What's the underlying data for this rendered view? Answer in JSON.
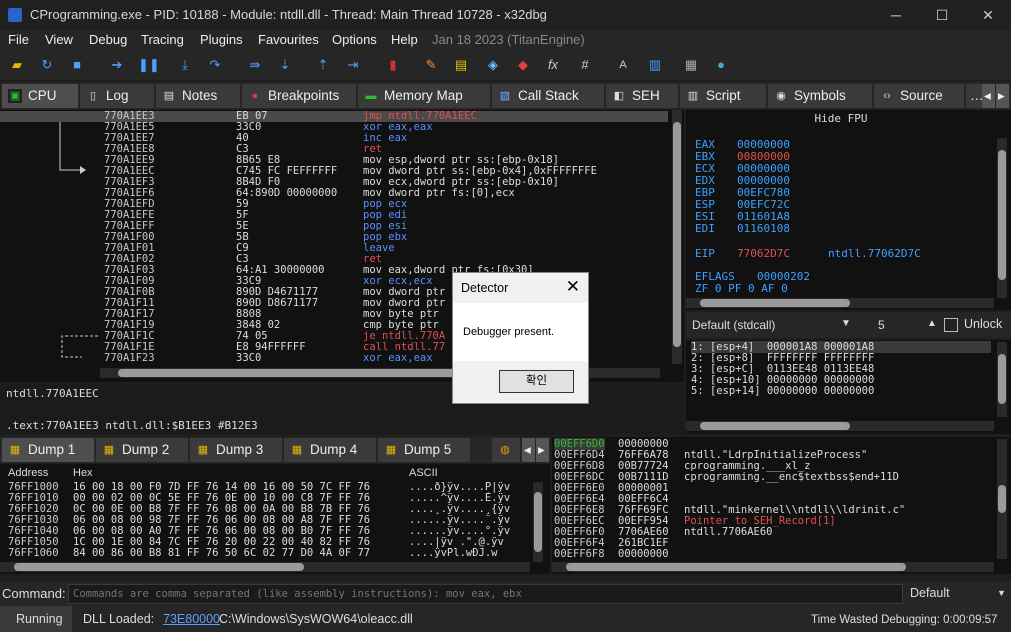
{
  "window": {
    "title": "CProgramming.exe - PID: 10188 - Module: ntdll.dll - Thread: Main Thread 10728 - x32dbg",
    "minimize": "─",
    "maximize": "☐",
    "close": "✕"
  },
  "menu": [
    "File",
    "View",
    "Debug",
    "Tracing",
    "Plugins",
    "Favourites",
    "Options",
    "Help",
    "Jan 18 2023 (TitanEngine)"
  ],
  "toolbar_icons": [
    "open-icon",
    "restart-icon",
    "stop-icon",
    "run-icon",
    "pause-icon",
    "step-into-icon",
    "step-over-icon",
    "trace-into-icon",
    "trace-over-icon",
    "execute-till-return-icon",
    "run-to-user-code-icon",
    "scylla-icon",
    "patch-icon",
    "comment-icon",
    "label-icon",
    "bookmark-icon",
    "function-icon",
    "hash-icon",
    "font-icon",
    "script-icon",
    "calculator-icon",
    "help-icon"
  ],
  "tabs": [
    {
      "label": "CPU",
      "icon": "cpu-icon"
    },
    {
      "label": "Log",
      "icon": "log-icon"
    },
    {
      "label": "Notes",
      "icon": "notes-icon"
    },
    {
      "label": "Breakpoints",
      "icon": "breakpoint-icon"
    },
    {
      "label": "Memory Map",
      "icon": "memory-map-icon"
    },
    {
      "label": "Call Stack",
      "icon": "call-stack-icon"
    },
    {
      "label": "SEH",
      "icon": "seh-icon"
    },
    {
      "label": "Script",
      "icon": "script-icon"
    },
    {
      "label": "Symbols",
      "icon": "symbols-icon"
    },
    {
      "label": "Source",
      "icon": "source-icon"
    },
    {
      "label": "…",
      "icon": ""
    }
  ],
  "disasm": [
    {
      "addr": "770A1EE3",
      "bytes": "EB 07",
      "instr": "jmp ntdll.770A1EEC",
      "cls": "kw",
      "hl": true
    },
    {
      "addr": "770A1EE5",
      "bytes": "33C0",
      "instr": "xor eax,eax",
      "cls": "kw2"
    },
    {
      "addr": "770A1EE7",
      "bytes": "40",
      "instr": "inc eax",
      "cls": "kw2"
    },
    {
      "addr": "770A1EE8",
      "bytes": "C3",
      "instr": "ret",
      "cls": "kw"
    },
    {
      "addr": "770A1EE9",
      "bytes": "8B65 E8",
      "instr": "mov esp,dword ptr ss:[ebp-0x18]",
      "cls": ""
    },
    {
      "addr": "770A1EEC",
      "bytes": "C745 FC FEFFFFFF",
      "instr": "mov dword ptr ss:[ebp-0x4],0xFFFFFFFE",
      "cls": ""
    },
    {
      "addr": "770A1EF3",
      "bytes": "8B4D F0",
      "instr": "mov ecx,dword ptr ss:[ebp-0x10]",
      "cls": ""
    },
    {
      "addr": "770A1EF6",
      "bytes": "64:890D 00000000",
      "instr": "mov dword ptr fs:[0],ecx",
      "cls": ""
    },
    {
      "addr": "770A1EFD",
      "bytes": "59",
      "instr": "pop ecx",
      "cls": "kw2"
    },
    {
      "addr": "770A1EFE",
      "bytes": "5F",
      "instr": "pop edi",
      "cls": "kw2"
    },
    {
      "addr": "770A1EFF",
      "bytes": "5E",
      "instr": "pop esi",
      "cls": "kw2"
    },
    {
      "addr": "770A1F00",
      "bytes": "5B",
      "instr": "pop ebx",
      "cls": "kw2"
    },
    {
      "addr": "770A1F01",
      "bytes": "C9",
      "instr": "leave",
      "cls": "kw2"
    },
    {
      "addr": "770A1F02",
      "bytes": "C3",
      "instr": "ret",
      "cls": "kw"
    },
    {
      "addr": "770A1F03",
      "bytes": "64:A1 30000000",
      "instr": "mov eax,dword ptr fs:[0x30]",
      "cls": ""
    },
    {
      "addr": "770A1F09",
      "bytes": "33C9",
      "instr": "xor ecx,ecx",
      "cls": "kw2"
    },
    {
      "addr": "770A1F0B",
      "bytes": "890D D4671177",
      "instr": "mov dword ptr",
      "cls": ""
    },
    {
      "addr": "770A1F11",
      "bytes": "890D D8671177",
      "instr": "mov dword ptr",
      "cls": ""
    },
    {
      "addr": "770A1F17",
      "bytes": "8808",
      "instr": "mov byte ptr",
      "cls": ""
    },
    {
      "addr": "770A1F19",
      "bytes": "3848 02",
      "instr": "cmp byte ptr",
      "cls": ""
    },
    {
      "addr": "770A1F1C",
      "bytes": "74 05",
      "instr": "je ntdll.770A",
      "cls": "kw"
    },
    {
      "addr": "770A1F1E",
      "bytes": "E8 94FFFFFF",
      "instr": "call ntdll.77",
      "cls": "kw"
    },
    {
      "addr": "770A1F23",
      "bytes": "33C0",
      "instr": "xor eax,eax",
      "cls": "kw2"
    }
  ],
  "disasm_info": {
    "line1": "ntdll.770A1EEC",
    "line2": ".text:770A1EE3 ntdll.dll:$B1EE3 #B12E3"
  },
  "registers": {
    "header": "Hide FPU",
    "list": [
      [
        "EAX",
        "00000000",
        ""
      ],
      [
        "EBX",
        "00800000",
        ""
      ],
      [
        "ECX",
        "00000000",
        ""
      ],
      [
        "EDX",
        "00000000",
        ""
      ],
      [
        "EBP",
        "00EFC780",
        ""
      ],
      [
        "ESP",
        "00EFC72C",
        ""
      ],
      [
        "ESI",
        "011601A8",
        ""
      ],
      [
        "EDI",
        "01160108",
        ""
      ]
    ],
    "eip": [
      "EIP",
      "77062D7C",
      "ntdll.77062D7C"
    ],
    "eflags": [
      "EFLAGS",
      "00000202"
    ],
    "flags": "ZF 0  PF 0  AF 0"
  },
  "callconv": {
    "selected": "Default (stdcall)",
    "count": "5",
    "unlock": "Unlock"
  },
  "args": [
    "1: [esp+4]  000001A8 000001A8",
    "2: [esp+8]  FFFFFFFF FFFFFFFF",
    "3: [esp+C]  0113EE48 0113EE48",
    "4: [esp+10] 00000000 00000000",
    "5: [esp+14] 00000000 00000000"
  ],
  "dump_tabs": [
    "Dump 1",
    "Dump 2",
    "Dump 3",
    "Dump 4",
    "Dump 5"
  ],
  "dump_header": {
    "address": "Address",
    "hex": "Hex",
    "ascii": "ASCII"
  },
  "dump_rows": [
    {
      "addr": "76FF1000",
      "hex": "16 00 18 00 F0 7D FF 76 14 00 16 00 50 7C FF 76",
      "ascii": "....ð}ÿv....P|ÿv"
    },
    {
      "addr": "76FF1010",
      "hex": "00 00 02 00 0C 5E FF 76 0E 00 10 00 C8 7F FF 76",
      "ascii": ".....^ÿv....È.ÿv"
    },
    {
      "addr": "76FF1020",
      "hex": "0C 00 0E 00 B8 7F FF 76 08 00 0A 00 B8 7B FF 76",
      "ascii": "....¸.ÿv....¸{ÿv"
    },
    {
      "addr": "76FF1030",
      "hex": "06 00 08 00 98 7F FF 76 06 00 08 00 A8 7F FF 76",
      "ascii": "......ÿv....¨.ÿv"
    },
    {
      "addr": "76FF1040",
      "hex": "06 00 08 00 A0 7F FF 76 06 00 08 00 B0 7F FF 76",
      "ascii": "......ÿv....°.ÿv"
    },
    {
      "addr": "76FF1050",
      "hex": "1C 00 1E 00 84 7C FF 76 20 00 22 00 40 82 FF 76",
      "ascii": "....|ÿv .\".@.ÿv"
    },
    {
      "addr": "76FF1060",
      "hex": "84 00 86 00 B8 81 FF 76 50 6C 02 77 D0 4A 0F 77",
      "ascii": "....ÿvPl.wÐJ.w"
    }
  ],
  "stack": [
    {
      "addr": "00EFF6D0",
      "val": "00000000",
      "cmt": "",
      "hl": true
    },
    {
      "addr": "00EFF6D4",
      "val": "76FF6A78",
      "cmt": "ntdll.\"LdrpInitializeProcess\""
    },
    {
      "addr": "00EFF6D8",
      "val": "00B77724",
      "cmt": "cprogramming.___xl_z"
    },
    {
      "addr": "00EFF6DC",
      "val": "00B7111D",
      "cmt": "cprogramming.__enc$textbss$end+11D"
    },
    {
      "addr": "00EFF6E0",
      "val": "00000001",
      "cmt": ""
    },
    {
      "addr": "00EFF6E4",
      "val": "00EFF6C4",
      "cmt": ""
    },
    {
      "addr": "00EFF6E8",
      "val": "76FF69FC",
      "cmt": "ntdll.\"minkernel\\\\ntdll\\\\ldrinit.c\""
    },
    {
      "addr": "00EFF6EC",
      "val": "00EFF954",
      "cmt": "Pointer to SEH_Record[1]",
      "red": true
    },
    {
      "addr": "00EFF6F0",
      "val": "7706AE60",
      "cmt": "ntdll.7706AE60"
    },
    {
      "addr": "00EFF6F4",
      "val": "261BC1EF",
      "cmt": ""
    },
    {
      "addr": "00EFF6F8",
      "val": "00000000",
      "cmt": ""
    }
  ],
  "command": {
    "label": "Command:",
    "placeholder": "Commands are comma separated (like assembly instructions): mov eax, ebx",
    "mode": "Default"
  },
  "status": {
    "state": "Running",
    "dll_label": "DLL Loaded:",
    "dll_addr": "73E80000",
    "dll_path": "C:\\Windows\\SysWOW64\\oleacc.dll",
    "time": "Time Wasted Debugging: 0:00:09:57"
  },
  "dialog": {
    "title": "Detector",
    "message": "Debugger present.",
    "ok": "확인",
    "close": "✕"
  },
  "colors": {
    "accent": "#3ea0ff",
    "red": "#e05050",
    "blue": "#5a90ff",
    "green": "#2dbd2d"
  }
}
